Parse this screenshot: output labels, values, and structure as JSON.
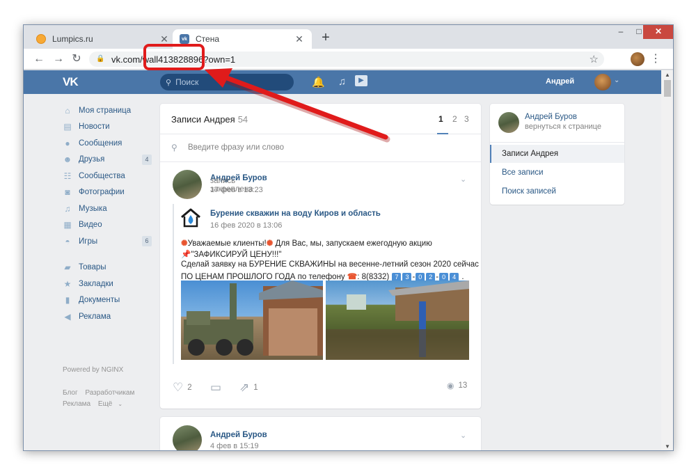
{
  "browser": {
    "tabs": [
      {
        "title": "Lumpics.ru",
        "active": false
      },
      {
        "title": "Стена",
        "active": true
      }
    ],
    "url": "vk.com/wall413828896?own=1"
  },
  "header": {
    "logo": "VK",
    "search_placeholder": "Поиск",
    "user_name": "Андрей"
  },
  "left_nav": {
    "items": [
      {
        "label": "Моя страница",
        "icon": "home-icon",
        "count": ""
      },
      {
        "label": "Новости",
        "icon": "news-icon",
        "count": ""
      },
      {
        "label": "Сообщения",
        "icon": "message-icon",
        "count": ""
      },
      {
        "label": "Друзья",
        "icon": "friends-icon",
        "count": "4"
      },
      {
        "label": "Сообщества",
        "icon": "groups-icon",
        "count": ""
      },
      {
        "label": "Фотографии",
        "icon": "camera-icon",
        "count": ""
      },
      {
        "label": "Музыка",
        "icon": "music-icon",
        "count": ""
      },
      {
        "label": "Видео",
        "icon": "video-icon",
        "count": ""
      },
      {
        "label": "Игры",
        "icon": "gamepad-icon",
        "count": "6"
      }
    ],
    "items2": [
      {
        "label": "Товары",
        "icon": "bag-icon"
      },
      {
        "label": "Закладки",
        "icon": "star-icon"
      },
      {
        "label": "Документы",
        "icon": "document-icon"
      },
      {
        "label": "Реклама",
        "icon": "megaphone-icon"
      }
    ],
    "powered": "Powered by NGINX",
    "footer": {
      "blog": "Блог",
      "dev": "Разработчикам",
      "ads": "Реклама",
      "more": "Ещё"
    }
  },
  "wall": {
    "title": "Записи Андрея",
    "count": "54",
    "pages": [
      "1",
      "2",
      "3"
    ],
    "search_placeholder": "Введите фразу или слово",
    "post": {
      "author": "Андрей Буров",
      "action": "запись закреплена",
      "date": "17 фев в 13:23",
      "repost_group": "Бурение скважин на воду Киров и область",
      "repost_date": "16 фев 2020 в 13:06",
      "line1": "Уважаемые клиенты!",
      "line1b": "Для Вас, мы, запускаем ежегодную акцию",
      "line2": "\"ЗАФИКСИРУЙ ЦЕНУ!!!\"",
      "line3": "Сделай заявку на БУРЕНИЕ СКВАЖИНЫ на весенне-летний сезон 2020 сейчас",
      "line4": "ПО ЦЕНАМ ПРОШЛОГО ГОДА по телефону",
      "phone_prefix": ": 8(8332)",
      "phone_digits": [
        "7",
        "3",
        "0",
        "2",
        "0",
        "4"
      ],
      "likes": "2",
      "shares": "1",
      "views": "13"
    },
    "post2": {
      "author": "Андрей Буров",
      "date": "4 фев в 15:19"
    }
  },
  "right_panel": {
    "name": "Андрей Буров",
    "back": "вернуться к странице",
    "items": [
      "Записи Андрея",
      "Все записи",
      "Поиск записей"
    ]
  },
  "colors": {
    "vk_blue": "#4a76a8",
    "link": "#2a5885",
    "annotation_red": "#e01b1b"
  }
}
